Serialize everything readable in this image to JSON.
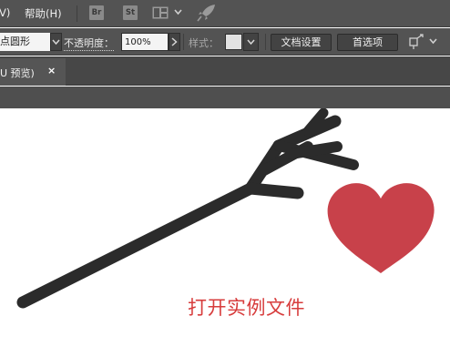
{
  "menubar": {
    "items": [
      "V)",
      "帮助(H)"
    ],
    "app_icons": {
      "bridge": "Br",
      "stock": "St"
    },
    "icons": [
      "arrange-documents-icon",
      "chevron-down-icon",
      "gpu-rocket-icon"
    ]
  },
  "controlbar": {
    "shape_value": "点圆形",
    "opacity_label": "不透明度：",
    "opacity_value": "100%",
    "style_label": "样式：",
    "document_setup_label": "文档设置",
    "preferences_label": "首选项",
    "icons": [
      "chevron-down-icon",
      "chevron-right-icon",
      "align-transform-icon"
    ]
  },
  "tabbar": {
    "tab_label": "U 预览)",
    "close_symbol": "×"
  },
  "canvas": {
    "caption": "打开实例文件",
    "objects": [
      "arrow-shape",
      "heart-shape"
    ],
    "colors": {
      "arrow": "#2b2b2b",
      "heart": "#c8414a",
      "caption": "#d73c3c"
    }
  }
}
